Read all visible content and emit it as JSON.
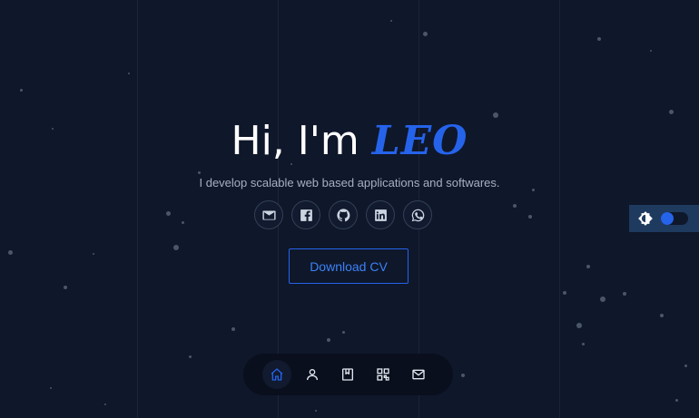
{
  "hero": {
    "greeting": "Hi, I'm",
    "name": "LEO",
    "tagline": "I develop scalable web based applications and softwares."
  },
  "socials": [
    {
      "icon": "mail-icon",
      "label": "Email"
    },
    {
      "icon": "facebook-icon",
      "label": "Facebook"
    },
    {
      "icon": "github-icon",
      "label": "GitHub"
    },
    {
      "icon": "linkedin-icon",
      "label": "LinkedIn"
    },
    {
      "icon": "whatsapp-icon",
      "label": "WhatsApp"
    }
  ],
  "cta": {
    "download_label": "Download CV"
  },
  "theme": {
    "icon": "brightness-icon",
    "dark_mode": true
  },
  "nav": {
    "active": "home",
    "items": [
      {
        "icon": "home-icon",
        "id": "home"
      },
      {
        "icon": "user-icon",
        "id": "about"
      },
      {
        "icon": "bookmark-icon",
        "id": "experience"
      },
      {
        "icon": "grid-icon",
        "id": "portfolio"
      },
      {
        "icon": "mail-icon",
        "id": "contact"
      }
    ]
  },
  "colors": {
    "background": "#0f172a",
    "accent": "#2563eb",
    "text_muted": "#a7b0c2"
  }
}
